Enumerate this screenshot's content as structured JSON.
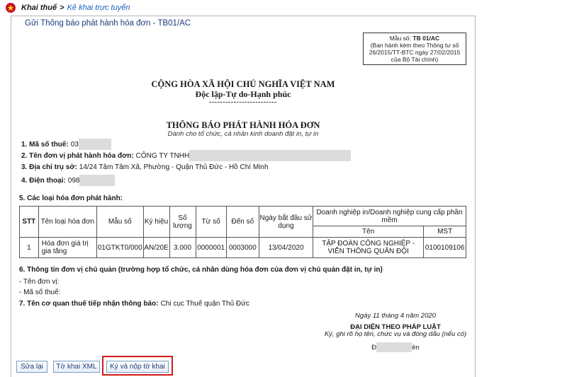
{
  "breadcrumb": {
    "home": "Khai thuế",
    "separator": ">",
    "current": "Kê khai trực tuyến"
  },
  "form_title": "Gửi Thông báo phát hành hóa đơn - TB01/AC",
  "template_box": {
    "label": "Mẫu số:",
    "code": "TB 01/AC",
    "line1": "(Ban hành kèm theo Thông tư số",
    "line2": "26/2015/TT-BTC ngày 27/02/2015",
    "line3": "của Bộ Tài chính)"
  },
  "header": {
    "nation": "CỘNG HÒA XÃ HỘI CHỦ NGHĨA VIỆT NAM",
    "motto": "Độc lập-Tự do-Hạnh phúc",
    "divider": "-------------------------"
  },
  "document": {
    "title": "THÔNG BÁO PHÁT HÀNH HÓA ĐƠN",
    "subtitle": "Dành cho tổ chức, cá nhân kinh doanh đặt in, tự in"
  },
  "fields": {
    "tax_code_label": "1. Mã số thuế:",
    "tax_code_value": "03",
    "company_label": "2. Tên đơn vị phát hành hóa đơn:",
    "company_value": "CÔNG TY TNHH",
    "address_label": "3. Địa chỉ trụ sở:",
    "address_value": "14/24 Tâm Tâm Xã, Phường - Quận Thủ Đức - Hồ Chí Minh",
    "phone_label": "4. Điện thoại:",
    "phone_value": "098"
  },
  "section5": "5. Các loại hóa đơn phát hành:",
  "table": {
    "headers": {
      "stt": "STT",
      "type": "Tên loại hóa đơn",
      "template": "Mẫu số",
      "symbol": "Ký hiệu",
      "quantity": "Số lượng",
      "from": "Từ số",
      "to": "Đến số",
      "start_date": "Ngày bắt đầu sử dụng",
      "printer_group": "Doanh nghiệp in/Doanh nghiệp cung cấp phần mềm",
      "printer_name": "Tên",
      "printer_mst": "MST"
    },
    "rows": [
      {
        "stt": "1",
        "type": "Hóa đơn giá trị gia tăng",
        "template": "01GTKT0/000",
        "symbol": "AN/20E",
        "quantity": "3.000",
        "from": "0000001",
        "to": "0003000",
        "start_date": "13/04/2020",
        "printer_name": "TẬP ĐOÀN CÔNG NGHIỆP - VIỄN THÔNG QUÂN ĐỘI",
        "printer_mst": "0100109106"
      }
    ]
  },
  "section6": "6. Thông tin đơn vị chủ quản (trường hợp tổ chức, cá nhân dùng hóa đơn của đơn vị chủ quản đặt in, tự in)",
  "parent_unit_name": "- Tên đơn vị:",
  "parent_tax_code": "- Mã số thuế:",
  "section7": {
    "label": "7. Tên cơ quan thuế tiếp nhận thông báo:",
    "value": "Chi cục Thuế quận Thủ Đức"
  },
  "signature": {
    "date": "Ngày 11 tháng 4 năm 2020",
    "title": "ĐẠI DIỆN THEO PHÁP LUẬT",
    "instructions": "Ký, ghi rõ họ tên, chức vụ và đóng dấu (nếu có)",
    "name_prefix": "Đ",
    "name_suffix": "ên"
  },
  "buttons": {
    "edit": "Sửa lại",
    "xml": "Tờ khai XML",
    "submit": "Ký và nộp tờ khai"
  },
  "colors": {
    "link": "#1560bd",
    "title": "#1c3d7a",
    "highlight": "#d11a1a",
    "emblem": "#c8102e"
  }
}
